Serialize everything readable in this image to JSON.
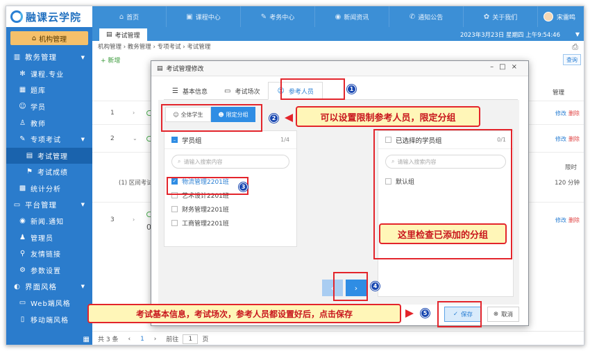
{
  "app": {
    "title": "融课云学院"
  },
  "nav": {
    "items": [
      {
        "label": "首页",
        "icon": "home-icon"
      },
      {
        "label": "课程中心",
        "icon": "book-icon"
      },
      {
        "label": "考务中心",
        "icon": "exam-icon"
      },
      {
        "label": "新闻资讯",
        "icon": "news-icon"
      },
      {
        "label": "通知公告",
        "icon": "notice-icon"
      },
      {
        "label": "关于我们",
        "icon": "about-icon"
      }
    ]
  },
  "user": {
    "name": "宋雷鸣"
  },
  "sidebar": {
    "org_button": "机构管理",
    "items": [
      {
        "label": "教务管理",
        "level": 0,
        "icon": "bars-icon",
        "caret": true
      },
      {
        "label": "课程.专业",
        "level": 1,
        "icon": "course-icon"
      },
      {
        "label": "题库",
        "level": 1,
        "icon": "question-bank-icon"
      },
      {
        "label": "学员",
        "level": 1,
        "icon": "student-icon"
      },
      {
        "label": "教师",
        "level": 1,
        "icon": "teacher-icon"
      },
      {
        "label": "专项考试",
        "level": 1,
        "icon": "exam-icon",
        "caret": true
      },
      {
        "label": "考试管理",
        "level": 2,
        "icon": "exam-manage-icon",
        "active": true
      },
      {
        "label": "考试成绩",
        "level": 2,
        "icon": "score-icon"
      },
      {
        "label": "统计分析",
        "level": 1,
        "icon": "stats-icon"
      },
      {
        "label": "平台管理",
        "level": 0,
        "icon": "platform-icon",
        "caret": true
      },
      {
        "label": "新闻.通知",
        "level": 1,
        "icon": "news-icon"
      },
      {
        "label": "管理员",
        "level": 1,
        "icon": "admin-icon"
      },
      {
        "label": "友情链接",
        "level": 1,
        "icon": "link-icon"
      },
      {
        "label": "参数设置",
        "level": 1,
        "icon": "settings-icon"
      },
      {
        "label": "界面风格",
        "level": 0,
        "icon": "style-icon",
        "caret": true
      },
      {
        "label": "Web端风格",
        "level": 1,
        "icon": "monitor-icon"
      },
      {
        "label": "移动端风格",
        "level": 1,
        "icon": "mobile-icon"
      }
    ]
  },
  "content": {
    "tab_label": "考试管理",
    "datetime": "2023年3月23日 星期四 上午9:54:46",
    "breadcrumb": "机构管理 › 教务管理 › 专项考试 › 考试管理",
    "add_label": "+ 新增",
    "query_label": "查询",
    "manage_header": "管理",
    "rows": [
      {
        "num": "1",
        "edit": "修改",
        "del": "删除"
      },
      {
        "num": "2",
        "edit": "修改",
        "del": "删除"
      },
      {
        "num": "3",
        "edit": "修改",
        "del": "删除"
      }
    ],
    "detail_text": "(1) 区间考试",
    "limit_label": "限时",
    "limit_value": "120 分钟",
    "row3_frag": "02",
    "pager": {
      "total": "共 3 条",
      "current": "1",
      "goto": "前往",
      "page_input": "1",
      "page_unit": "页"
    }
  },
  "dialog": {
    "title": "考试管理修改",
    "tabs": [
      {
        "label": "基本信息",
        "icon": "info-icon"
      },
      {
        "label": "考试场次",
        "icon": "monitor-icon"
      },
      {
        "label": "参考人员",
        "icon": "users-icon",
        "active": true
      }
    ],
    "segment": {
      "all": "全体学生",
      "limited": "限定分组"
    },
    "left_panel": {
      "title": "学员组",
      "count": "1/4",
      "search_placeholder": "请输入搜索内容",
      "groups": [
        {
          "label": "物流管理2201班",
          "checked": true
        },
        {
          "label": "艺术设计2201班",
          "checked": false
        },
        {
          "label": "财务管理2201班",
          "checked": false
        },
        {
          "label": "工商管理2201班",
          "checked": false
        }
      ]
    },
    "right_panel": {
      "title": "已选择的学员组",
      "count": "0/1",
      "search_placeholder": "请输入搜索内容",
      "groups": [
        {
          "label": "默认组",
          "checked": false
        }
      ]
    },
    "save_label": "保存",
    "cancel_label": "取消"
  },
  "annotations": {
    "callout_limit": "可以设置限制参考人员，限定分组",
    "callout_check": "这里检查已添加的分组",
    "callout_save": "考试基本信息，考试场次，参考人员都设置好后，点击保存",
    "badges": [
      "1",
      "2",
      "3",
      "4",
      "5"
    ],
    "colors": {
      "accent": "#2f8de4",
      "sidebar": "#2b7ccc",
      "annotation_red": "#e3242b",
      "callout_bg": "#fff6b8"
    }
  }
}
